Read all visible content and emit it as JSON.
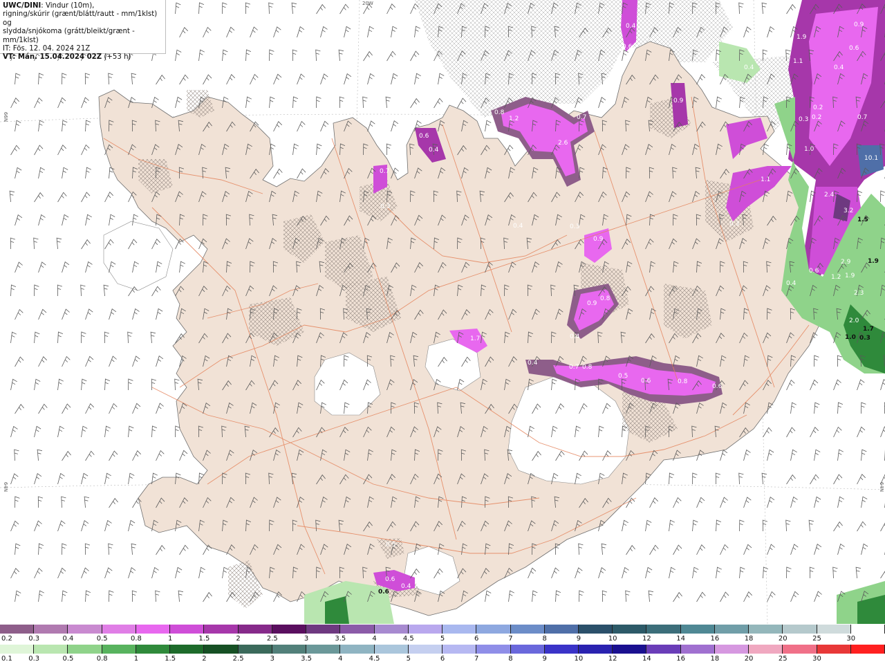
{
  "header": {
    "line1_bold": "UWC/DINI",
    "line1_rest": ": Vindur (10m),",
    "line2": "rigning/skúrir (grænt/blátt/rautt - mm/1klst) og",
    "line3": "slydda/snjókoma (grátt/bleikt/grænt - mm/1klst)",
    "line4": "IT: Fös. 12. 04. 2024 21Z",
    "line5_bold": "VT: Mán. 15.04.2024 02Z",
    "line5_rest": " (+53 h)"
  },
  "coords": {
    "top_lon": "20W",
    "left_lat_upper": "66N",
    "left_lat_lower": "64N",
    "right_lat": "64N"
  },
  "map_values": [
    {
      "text": "0.4"
    },
    {
      "text": "0.6"
    },
    {
      "text": "0.9"
    },
    {
      "text": "1.9"
    },
    {
      "text": "1.1"
    },
    {
      "text": "0.6"
    },
    {
      "text": "0.4"
    },
    {
      "text": "0.2"
    },
    {
      "text": "0.3"
    },
    {
      "text": "0.2"
    },
    {
      "text": "0.7"
    },
    {
      "text": "1.0"
    },
    {
      "text": "10.1"
    },
    {
      "text": "1.1"
    },
    {
      "text": "2.4"
    },
    {
      "text": "3.2"
    },
    {
      "text": "1.5"
    },
    {
      "text": "0.3"
    },
    {
      "text": "0.6"
    },
    {
      "text": "2.9"
    },
    {
      "text": "1.9"
    },
    {
      "text": "1.2"
    },
    {
      "text": "1.9"
    },
    {
      "text": "0.4"
    },
    {
      "text": "2.3"
    },
    {
      "text": "2.0"
    },
    {
      "text": "1.7"
    },
    {
      "text": "1.0"
    },
    {
      "text": "0.3"
    },
    {
      "text": "1.2"
    },
    {
      "text": "2.6"
    },
    {
      "text": "0.7"
    },
    {
      "text": "0.8"
    },
    {
      "text": "0.6"
    },
    {
      "text": "0.4"
    },
    {
      "text": "0.9"
    },
    {
      "text": "0.3"
    },
    {
      "text": "0.4"
    },
    {
      "text": "0.9"
    },
    {
      "text": "0.8"
    },
    {
      "text": "0.4"
    },
    {
      "text": "1.7"
    },
    {
      "text": "0.4"
    },
    {
      "text": "0.7"
    },
    {
      "text": "0.8"
    },
    {
      "text": "0.5"
    },
    {
      "text": "0.6"
    },
    {
      "text": "0.8"
    },
    {
      "text": "0.6"
    },
    {
      "text": "0.7"
    },
    {
      "text": "0.3"
    },
    {
      "text": "0.9"
    },
    {
      "text": "0.4"
    },
    {
      "text": "0.6"
    },
    {
      "text": "0.5"
    },
    {
      "text": "0.4"
    },
    {
      "text": "0.6"
    }
  ],
  "legend_snow": {
    "labels": [
      "0.2",
      "0.3",
      "0.4",
      "0.5",
      "0.8",
      "1",
      "1.5",
      "2",
      "2.5",
      "3",
      "3.5",
      "4",
      "4.5",
      "5",
      "6",
      "7",
      "8",
      "9",
      "10",
      "12",
      "14",
      "16",
      "18",
      "20",
      "25",
      "30"
    ],
    "colors": [
      "#8e5e8a",
      "#b07ab0",
      "#c98ad0",
      "#e07ee6",
      "#e868ef",
      "#cf4ed8",
      "#a637aa",
      "#862a8a",
      "#5a0f5f",
      "#6e3980",
      "#8b5ba8",
      "#a78ad0",
      "#b9a8ee",
      "#a9b8ef",
      "#8ea8e0",
      "#6c8dc8",
      "#4f6fa8",
      "#2b506a",
      "#2d5a68",
      "#3c6e7a",
      "#4f8894",
      "#709ea8",
      "#94b7bb",
      "#b5c9cc",
      "#cfdbdc",
      "#ffffff"
    ]
  },
  "legend_rain": {
    "labels": [
      "0.1",
      "0.3",
      "0.5",
      "0.8",
      "1",
      "1.5",
      "2",
      "2.5",
      "3",
      "3.5",
      "4",
      "4.5",
      "5",
      "6",
      "7",
      "8",
      "9",
      "10",
      "12",
      "14",
      "16",
      "18",
      "20",
      "25",
      "30"
    ],
    "colors": [
      "#dff5d8",
      "#b9e6b0",
      "#8fd38a",
      "#58b35e",
      "#2f8a3b",
      "#1d6b2b",
      "#165024",
      "#3b6a5b",
      "#52807a",
      "#6b9899",
      "#8fb4c2",
      "#aac6dc",
      "#c5cff0",
      "#b6b8f2",
      "#8f8ee8",
      "#6a68dc",
      "#3a33c8",
      "#2a22b0",
      "#1a1090",
      "#6a3db8",
      "#a070d0",
      "#d698e0",
      "#f0a8c0",
      "#f07088",
      "#e83838",
      "#ff2020"
    ]
  }
}
